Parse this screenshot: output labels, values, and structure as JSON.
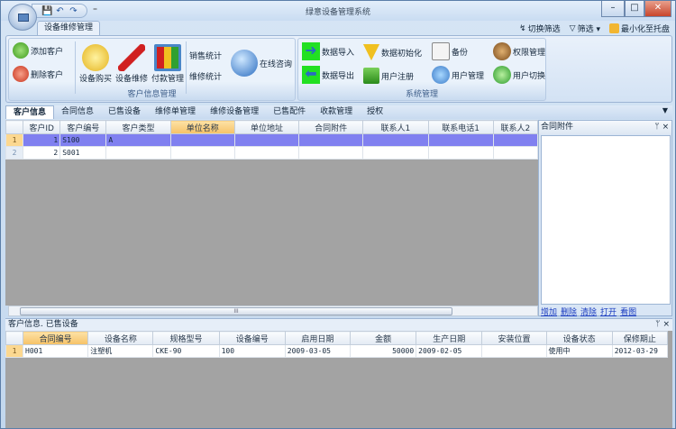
{
  "window": {
    "title": "绿意设备管理系统",
    "minimize": "–",
    "maximize": "□",
    "close": "✕"
  },
  "quick_access": {
    "save": "💾",
    "undo": "↶",
    "redo": "↷",
    "customize": "⁼"
  },
  "ribbon": {
    "tab": "设备维修管理",
    "top_right": {
      "toggle_filter": "切换筛选",
      "filter": "筛选 ▾",
      "minimize_tray": "最小化至托盘"
    },
    "group1": {
      "label": "客户信息管理",
      "add_customer": "添加客户",
      "delete_customer": "删除客户",
      "buy": "设备购买",
      "repair": "设备维修",
      "payment": "付款管理",
      "sales_stats": "销售统计",
      "repair_stats": "维修统计",
      "online": "在线咨询"
    },
    "group2": {
      "label": "系统管理",
      "import": "数据导入",
      "export": "数据导出",
      "init": "数据初始化",
      "register": "用户注册",
      "backup": "备份",
      "users": "用户管理",
      "permissions": "权限管理",
      "switch_user": "用户切换"
    }
  },
  "tabs": [
    "客户信息",
    "合同信息",
    "已售设备",
    "维修单管理",
    "维修设备管理",
    "已售配件",
    "收款管理",
    "授权"
  ],
  "customer_grid": {
    "columns": [
      "客户ID",
      "客户编号",
      "客户类型",
      "单位名称",
      "单位地址",
      "合同附件",
      "联系人1",
      "联系电话1",
      "联系人2"
    ],
    "rows": [
      [
        "1",
        "1",
        "S100",
        "A",
        "",
        "",
        "",
        "",
        "",
        ""
      ],
      [
        "2",
        "2",
        "S001",
        "",
        "",
        "",
        "",
        "",
        "",
        ""
      ]
    ]
  },
  "side_panel": {
    "title": "合同附件",
    "pin": "ᛘ",
    "close": "×",
    "links": [
      "增加",
      "删除",
      "清除",
      "打开",
      "看图"
    ]
  },
  "scroll_grip": "III",
  "bottom": {
    "title": "客户信息. 已售设备",
    "pin": "ᛘ",
    "close": "×",
    "columns": [
      "合同编号",
      "设备名称",
      "规格型号",
      "设备编号",
      "启用日期",
      "金额",
      "生产日期",
      "安装位置",
      "设备状态",
      "保修期止"
    ],
    "rows": [
      [
        "1",
        "H001",
        "注塑机",
        "CKE-90",
        "100",
        "2009-03-05",
        "50000",
        "2009-02-05",
        "",
        "使用中",
        "2012-03-29"
      ]
    ]
  },
  "colors": {
    "selected_row": "#8080f0",
    "highlight_header": "#f6c266",
    "grid_bg": "#a3a3a3"
  }
}
